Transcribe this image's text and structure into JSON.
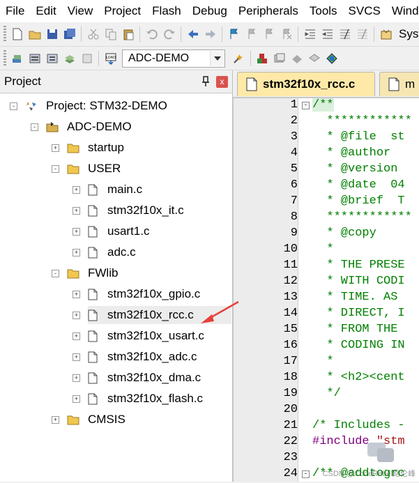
{
  "menu": [
    "File",
    "Edit",
    "View",
    "Project",
    "Flash",
    "Debug",
    "Peripherals",
    "Tools",
    "SVCS",
    "Window"
  ],
  "toolbar1": {
    "icons": [
      "new-file-icon",
      "open-folder-icon",
      "save-icon",
      "save-all-icon",
      "cut-icon",
      "copy-icon",
      "paste-icon",
      "undo-icon",
      "redo-icon",
      "nav-back-icon",
      "nav-forward-icon",
      "bookmark-icon",
      "prev-bookmark-icon",
      "next-bookmark-icon",
      "clear-bookmarks-icon",
      "indent-icon",
      "unindent-icon",
      "comment-icon",
      "uncomment-icon",
      "system-viewer-icon"
    ],
    "system_viewer_label": "SystemI"
  },
  "toolbar2": {
    "target_select": "ADC-DEMO"
  },
  "project_pane": {
    "title": "Project",
    "close_label": "x",
    "tree": [
      {
        "label": "Project: STM32-DEMO",
        "level": 0,
        "kind": "project"
      },
      {
        "label": "ADC-DEMO",
        "level": 1,
        "kind": "target"
      },
      {
        "label": "startup",
        "level": 2,
        "kind": "folder",
        "expander": "+"
      },
      {
        "label": "USER",
        "level": 2,
        "kind": "folder",
        "expander": "-"
      },
      {
        "label": "main.c",
        "level": 3,
        "kind": "file",
        "expander": "+"
      },
      {
        "label": "stm32f10x_it.c",
        "level": 3,
        "kind": "file",
        "expander": "+"
      },
      {
        "label": "usart1.c",
        "level": 3,
        "kind": "file",
        "expander": "+"
      },
      {
        "label": "adc.c",
        "level": 3,
        "kind": "file",
        "expander": "+"
      },
      {
        "label": "FWlib",
        "level": 2,
        "kind": "folder",
        "expander": "-"
      },
      {
        "label": "stm32f10x_gpio.c",
        "level": 3,
        "kind": "file",
        "expander": "+"
      },
      {
        "label": "stm32f10x_rcc.c",
        "level": 3,
        "kind": "file",
        "expander": "+",
        "highlighted": true
      },
      {
        "label": "stm32f10x_usart.c",
        "level": 3,
        "kind": "file",
        "expander": "+"
      },
      {
        "label": "stm32f10x_adc.c",
        "level": 3,
        "kind": "file",
        "expander": "+"
      },
      {
        "label": "stm32f10x_dma.c",
        "level": 3,
        "kind": "file",
        "expander": "+"
      },
      {
        "label": "stm32f10x_flash.c",
        "level": 3,
        "kind": "file",
        "expander": "+"
      },
      {
        "label": "CMSIS",
        "level": 2,
        "kind": "folder",
        "expander": "+"
      }
    ]
  },
  "editor": {
    "tabs": [
      {
        "label": "stm32f10x_rcc.c",
        "active": true
      },
      {
        "label": "m",
        "active": false
      }
    ],
    "lines": [
      {
        "n": "1",
        "code": "/**",
        "style": "first",
        "fold": "-"
      },
      {
        "n": "2",
        "code": "  ************",
        "style": "comment"
      },
      {
        "n": "3",
        "code": "  * @file  st",
        "style": "comment"
      },
      {
        "n": "4",
        "code": "  * @author",
        "style": "comment"
      },
      {
        "n": "5",
        "code": "  * @version",
        "style": "comment"
      },
      {
        "n": "6",
        "code": "  * @date  04",
        "style": "comment"
      },
      {
        "n": "7",
        "code": "  * @brief  T",
        "style": "comment"
      },
      {
        "n": "8",
        "code": "  ************",
        "style": "comment"
      },
      {
        "n": "9",
        "code": "  * @copy",
        "style": "comment"
      },
      {
        "n": "10",
        "code": "  *",
        "style": "comment"
      },
      {
        "n": "11",
        "code": "  * THE PRESE",
        "style": "comment"
      },
      {
        "n": "12",
        "code": "  * WITH CODI",
        "style": "comment"
      },
      {
        "n": "13",
        "code": "  * TIME. AS ",
        "style": "comment"
      },
      {
        "n": "14",
        "code": "  * DIRECT, I",
        "style": "comment"
      },
      {
        "n": "15",
        "code": "  * FROM THE ",
        "style": "comment"
      },
      {
        "n": "16",
        "code": "  * CODING IN",
        "style": "comment"
      },
      {
        "n": "17",
        "code": "  *",
        "style": "comment"
      },
      {
        "n": "18",
        "code": "  * <h2><cent",
        "style": "comment"
      },
      {
        "n": "19",
        "code": "  */",
        "style": "comment"
      },
      {
        "n": "20",
        "code": "",
        "style": "comment"
      },
      {
        "n": "21",
        "code": "/* Includes -",
        "style": "comment"
      },
      {
        "n": "22",
        "code": "#include \"stm",
        "style": "dir"
      },
      {
        "n": "23",
        "code": "",
        "style": "comment"
      },
      {
        "n": "24",
        "code": "/** @addtogrc",
        "style": "comment",
        "fold": "-"
      }
    ]
  },
  "watermark": "CSDN @CodeRebel路伦峰",
  "colors": {
    "comment": "#008000",
    "directive": "#800080",
    "tab_active": "#ffe9a8",
    "arrow": "#e8403a"
  }
}
